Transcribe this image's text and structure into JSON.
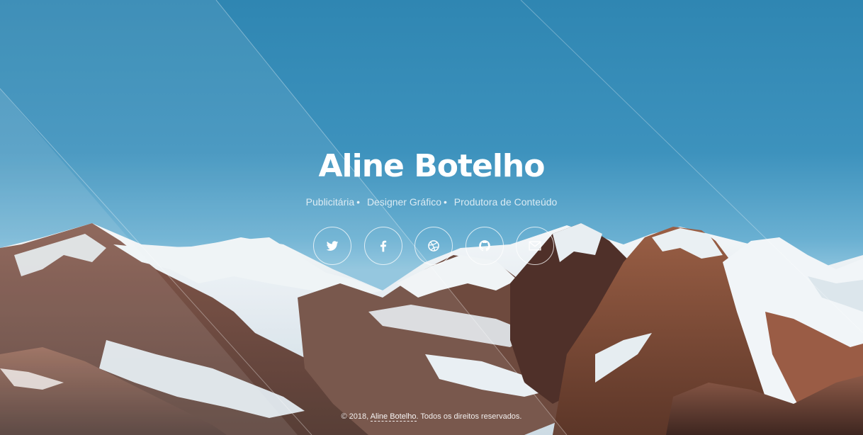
{
  "profile": {
    "name": "Aline Botelho",
    "roles": [
      "Publicitária",
      "Designer Gráfico",
      "Produtora de Conteúdo"
    ],
    "role_separator": "•"
  },
  "social": [
    {
      "id": "twitter",
      "icon": "twitter-icon"
    },
    {
      "id": "facebook",
      "icon": "facebook-icon"
    },
    {
      "id": "dribbble",
      "icon": "dribbble-icon"
    },
    {
      "id": "github",
      "icon": "github-icon"
    },
    {
      "id": "email",
      "icon": "envelope-icon"
    }
  ],
  "footer": {
    "prefix": "© 2018,",
    "link_text": "Aline Botelho",
    "suffix": ". Todos os direitos reservados."
  },
  "colors": {
    "sky_top": "#2f86b2",
    "sky_bottom": "#8cc3dd",
    "snow": "#e8eef2",
    "rock_dark": "#5a3a30",
    "rock_brown": "#8b5a46",
    "text": "#ffffff"
  }
}
